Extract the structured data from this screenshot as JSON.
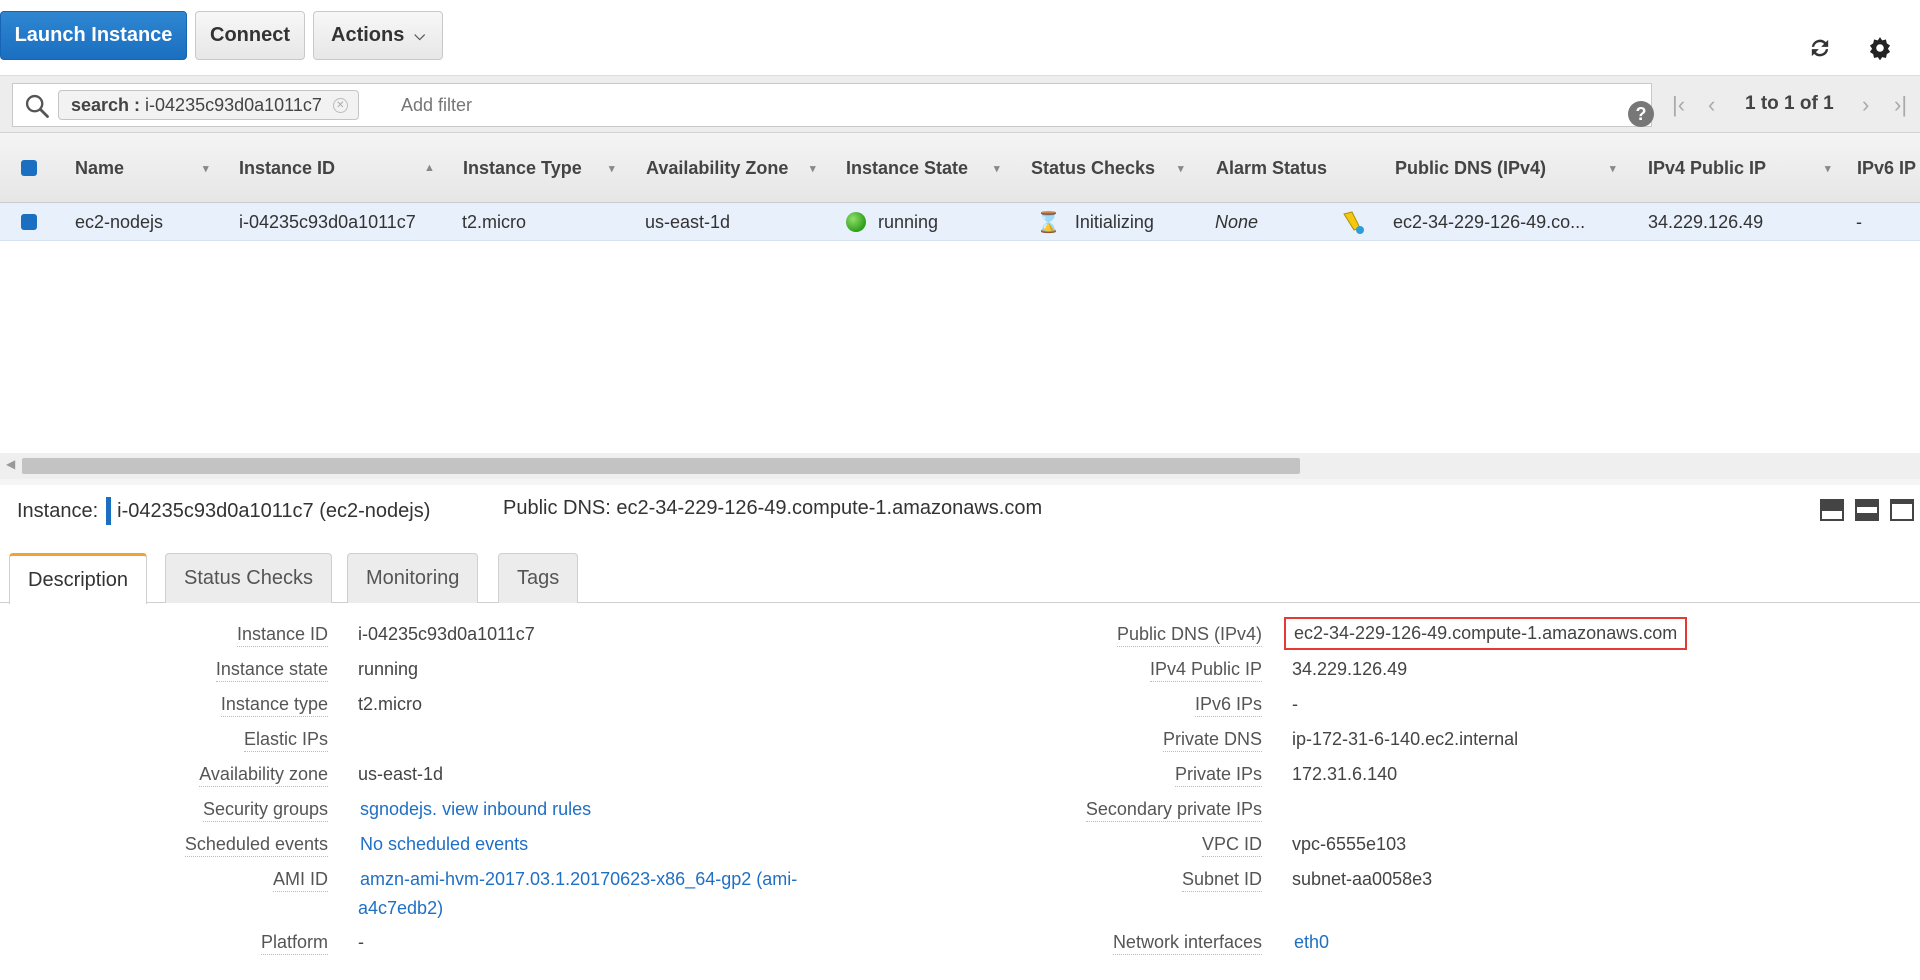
{
  "toolbar": {
    "launch_label": "Launch Instance",
    "connect_label": "Connect",
    "actions_label": "Actions",
    "refresh_icon": "refresh-icon",
    "settings_icon": "gear-icon"
  },
  "filter": {
    "token_key": "search :",
    "token_value": "i-04235c93d0a1011c7",
    "placeholder": "Add filter",
    "help": "?",
    "page_info": "1 to 1 of 1"
  },
  "grid": {
    "columns": [
      "Name",
      "Instance ID",
      "Instance Type",
      "Availability Zone",
      "Instance State",
      "Status Checks",
      "Alarm Status",
      "Public DNS (IPv4)",
      "IPv4 Public IP",
      "IPv6 IP"
    ],
    "row": {
      "name": "ec2-nodejs",
      "instance_id": "i-04235c93d0a1011c7",
      "instance_type": "t2.micro",
      "availability_zone": "us-east-1d",
      "instance_state": "running",
      "status_checks": "Initializing",
      "alarm_status": "None",
      "public_dns": "ec2-34-229-126-49.co...",
      "ipv4_public_ip": "34.229.126.49",
      "ipv6_ip": "-"
    }
  },
  "detail": {
    "instance_label": "Instance:",
    "instance_value": "i-04235c93d0a1011c7 (ec2-nodejs)",
    "public_dns_header": "Public DNS: ec2-34-229-126-49.compute-1.amazonaws.com",
    "tabs": [
      "Description",
      "Status Checks",
      "Monitoring",
      "Tags"
    ],
    "left": {
      "instance_id": {
        "k": "Instance ID",
        "v": "i-04235c93d0a1011c7"
      },
      "instance_state": {
        "k": "Instance state",
        "v": "running"
      },
      "instance_type": {
        "k": "Instance type",
        "v": "t2.micro"
      },
      "elastic_ips": {
        "k": "Elastic IPs",
        "v": ""
      },
      "availability_zone": {
        "k": "Availability zone",
        "v": "us-east-1d"
      },
      "security_groups": {
        "k": "Security groups",
        "v1": "sgnodejs.",
        "v2": "view inbound rules"
      },
      "scheduled_events": {
        "k": "Scheduled events",
        "v": "No scheduled events"
      },
      "ami_id": {
        "k": "AMI ID",
        "v1": "amzn-ami-hvm-2017.03.1.20170623-x86_64-gp2 (ami-",
        "v2": "a4c7edb2)"
      },
      "platform": {
        "k": "Platform",
        "v": "-"
      }
    },
    "right": {
      "public_dns": {
        "k": "Public DNS (IPv4)",
        "v": "ec2-34-229-126-49.compute-1.amazonaws.com"
      },
      "ipv4_public_ip": {
        "k": "IPv4 Public IP",
        "v": "34.229.126.49"
      },
      "ipv6_ips": {
        "k": "IPv6 IPs",
        "v": "-"
      },
      "private_dns": {
        "k": "Private DNS",
        "v": "ip-172-31-6-140.ec2.internal"
      },
      "private_ips": {
        "k": "Private IPs",
        "v": "172.31.6.140"
      },
      "secondary_private_ips": {
        "k": "Secondary private IPs",
        "v": ""
      },
      "vpc_id": {
        "k": "VPC ID",
        "v": "vpc-6555e103"
      },
      "subnet_id": {
        "k": "Subnet ID",
        "v": "subnet-aa0058e3"
      },
      "network_interfaces": {
        "k": "Network interfaces",
        "v": "eth0"
      }
    }
  },
  "colors": {
    "primary": "#1a6fc0",
    "highlight_border": "#e53935",
    "link": "#1f6fc5",
    "active_tab_accent": "#f0a330"
  }
}
